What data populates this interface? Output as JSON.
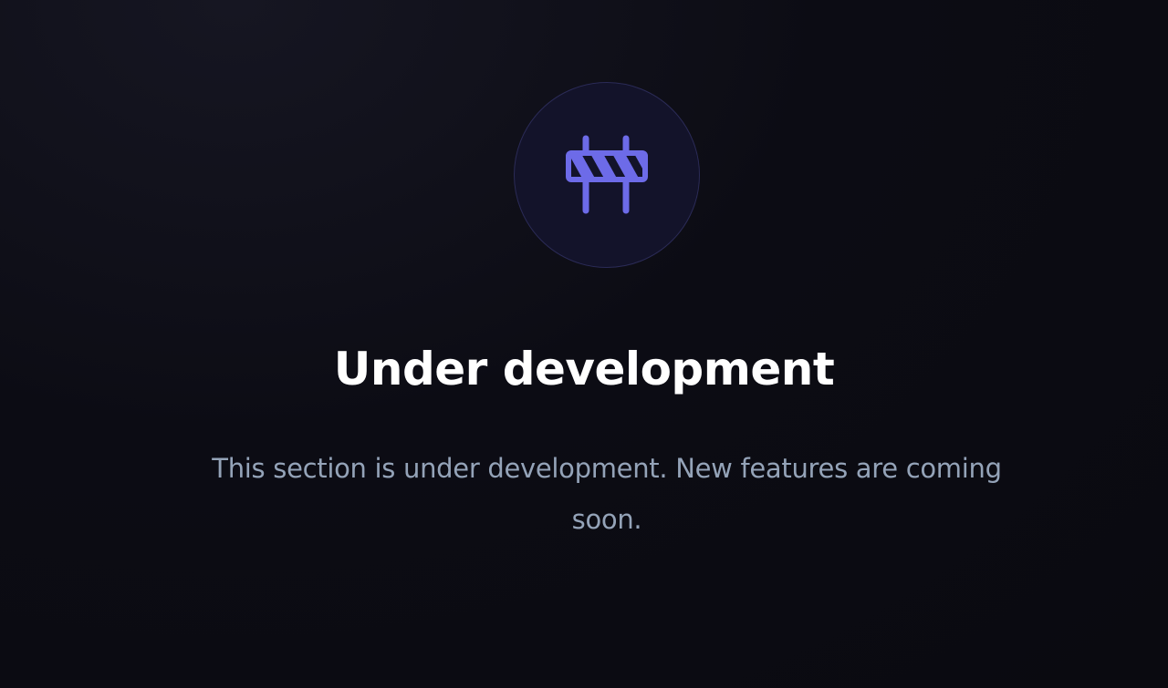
{
  "empty_state": {
    "icon": "barrier-icon",
    "accent_color": "#6d6be8",
    "title": "Under development",
    "description": "This section is under development. New features are coming soon."
  }
}
